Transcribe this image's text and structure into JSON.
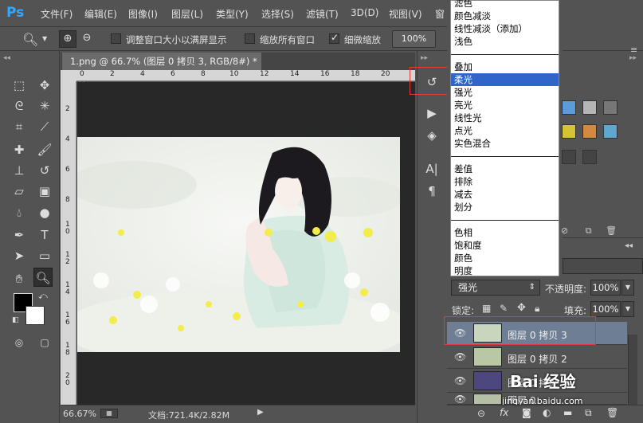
{
  "app": {
    "logo": "Ps"
  },
  "menu": [
    "文件(F)",
    "编辑(E)",
    "图像(I)",
    "图层(L)",
    "类型(Y)",
    "选择(S)",
    "滤镜(T)",
    "3D(D)",
    "视图(V)",
    "窗"
  ],
  "options": {
    "resize_windows": "调整窗口大小以满屏显示",
    "zoom_all": "缩放所有窗口",
    "scrubby": "细微缩放",
    "zoom_value": "100%"
  },
  "document": {
    "tab_title": "1.png @ 66.7% (图层 0 拷贝 3, RGB/8#) *",
    "close": "×",
    "ruler_top": [
      "0",
      "2",
      "4",
      "6",
      "8",
      "10",
      "12",
      "14",
      "16",
      "18",
      "20"
    ],
    "ruler_left": [
      "2",
      "4",
      "6",
      "8",
      "1\n0",
      "1\n2",
      "1\n4",
      "1\n6",
      "1\n8",
      "2\n0"
    ]
  },
  "status": {
    "zoom": "66.67%",
    "doc_info": "文档:721.4K/2.82M"
  },
  "blend_modes": {
    "group1": [
      "滤色",
      "颜色减淡",
      "线性减淡（添加）",
      "浅色"
    ],
    "group2": [
      "叠加",
      "柔光",
      "强光",
      "亮光",
      "线性光",
      "点光",
      "实色混合"
    ],
    "group3": [
      "差值",
      "排除",
      "减去",
      "划分"
    ],
    "group4": [
      "色相",
      "饱和度",
      "颜色",
      "明度"
    ],
    "highlighted": "柔光"
  },
  "layers": {
    "blend_value": "强光",
    "opacity_label": "不透明度:",
    "opacity_value": "100%",
    "lock_label": "锁定:",
    "fill_label": "填充:",
    "fill_value": "100%",
    "rows": [
      {
        "name": "图层 0 拷贝 3"
      },
      {
        "name": "图层 0 拷贝 2"
      },
      {
        "name": "图层 0 拷贝"
      },
      {
        "name": "图层 0"
      }
    ]
  },
  "watermark": {
    "text": "Bai 经验",
    "sub": "jingyan.baidu.com"
  },
  "colors": {
    "accent": "#3166c9",
    "highlight_box": "#e23a3a",
    "selected_layer": "#6e7f95"
  }
}
